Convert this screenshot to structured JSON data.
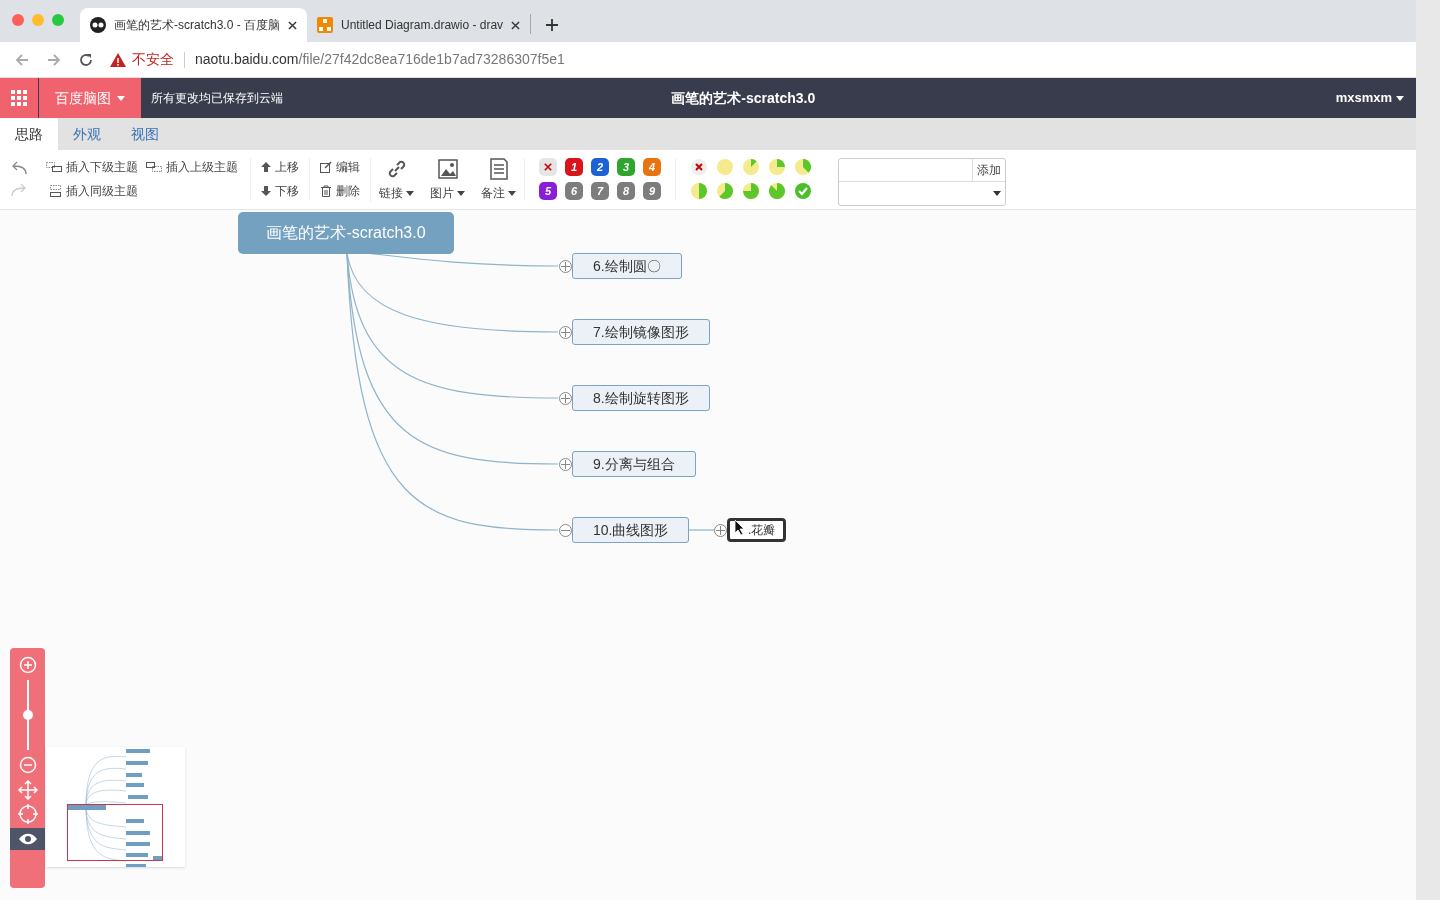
{
  "browser": {
    "tabs": [
      {
        "title": "画笔的艺术-scratch3.0 - 百度脑",
        "selected": true,
        "kind": "owl"
      },
      {
        "title": "Untitled Diagram.drawio - drav",
        "selected": false,
        "kind": "drawio"
      }
    ],
    "security": "不安全",
    "url_host": "naotu.baidu.com",
    "url_path": "/file/27f42dc8ea716de1b7ad73286307f5e1"
  },
  "header": {
    "brand": "百度脑图",
    "save_status": "所有更改均已保存到云端",
    "title": "画笔的艺术-scratch3.0",
    "user": "mxsmxm"
  },
  "tabs": [
    {
      "label": "思路",
      "selected": true
    },
    {
      "label": "外观",
      "selected": false
    },
    {
      "label": "视图",
      "selected": false
    }
  ],
  "toolbar": {
    "insert_child": "插入下级主题",
    "insert_parent": "插入上级主题",
    "insert_sibling": "插入同级主题",
    "move_up": "上移",
    "move_down": "下移",
    "edit": "编辑",
    "delete": "删除",
    "link": "链接",
    "image": "图片",
    "note": "备注",
    "add_button": "添加"
  },
  "priorities": [
    {
      "label": "1",
      "color": "#d9141c"
    },
    {
      "label": "2",
      "color": "#1c62d6"
    },
    {
      "label": "3",
      "color": "#2ea52e"
    },
    {
      "label": "4",
      "color": "#e8740f"
    },
    {
      "label": "5",
      "color": "#8a1ed6"
    },
    {
      "label": "6",
      "color": "#7d7d7d"
    },
    {
      "label": "7",
      "color": "#7d7d7d"
    },
    {
      "label": "8",
      "color": "#7d7d7d"
    },
    {
      "label": "9",
      "color": "#7d7d7d"
    }
  ],
  "mindmap": {
    "root": "画笔的艺术-scratch3.0",
    "nodes": [
      {
        "label": "6.绘制圆〇",
        "expanded": false
      },
      {
        "label": "7.绘制镜像图形",
        "expanded": false
      },
      {
        "label": "8.绘制旋转图形",
        "expanded": false
      },
      {
        "label": "9.分离与组合",
        "expanded": false
      },
      {
        "label": "10.曲线图形",
        "expanded": true,
        "children": [
          {
            "label": ".花瓣",
            "selected": true,
            "expanded": false
          }
        ]
      }
    ]
  },
  "zoom_slider": {
    "level": 0.5
  },
  "navigator": {
    "on": true
  }
}
